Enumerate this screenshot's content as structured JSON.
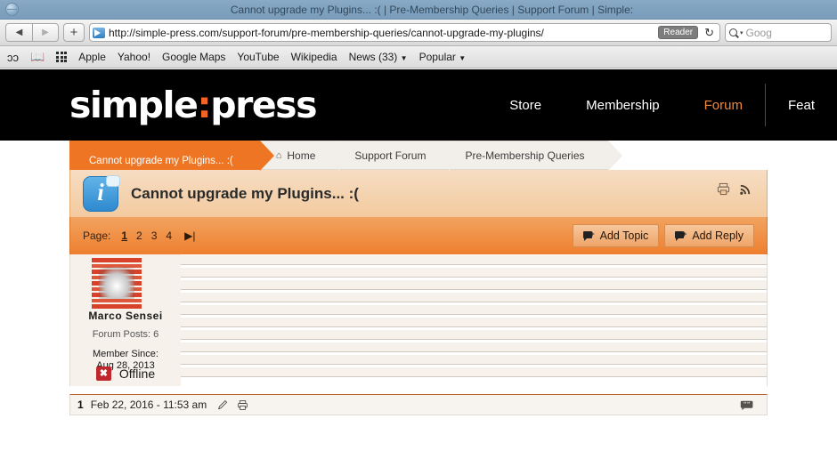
{
  "window": {
    "title": "Cannot upgrade my Plugins... :( | Pre-Membership Queries | Support Forum | Simple:",
    "globe_icon": "globe-icon"
  },
  "toolbar": {
    "back_label": "◀",
    "forward_label": "▶",
    "new_tab_label": "+",
    "url": "http://simple-press.com/support-forum/pre-membership-queries/cannot-upgrade-my-plugins/",
    "reader_label": "Reader",
    "reload_label": "↻",
    "search_placeholder": "Goog",
    "favicon_name": "rss-favicon"
  },
  "bookmarks": {
    "icons": [
      "reading-glasses-icon",
      "book-icon",
      "grid-apps-icon"
    ],
    "items": [
      {
        "label": "Apple",
        "caret": false
      },
      {
        "label": "Yahoo!",
        "caret": false
      },
      {
        "label": "Google Maps",
        "caret": false
      },
      {
        "label": "YouTube",
        "caret": false
      },
      {
        "label": "Wikipedia",
        "caret": false
      },
      {
        "label": "News (33)",
        "caret": true
      },
      {
        "label": "Popular",
        "caret": true
      }
    ],
    "caret_glyph": "▼"
  },
  "site": {
    "logo_left": "simple",
    "logo_colon": ":",
    "logo_right": "press",
    "nav": [
      {
        "label": "Store",
        "active": false
      },
      {
        "label": "Membership",
        "active": false
      },
      {
        "label": "Forum",
        "active": true
      },
      {
        "label": "Feat",
        "active": false
      }
    ]
  },
  "breadcrumb": {
    "current": "Cannot upgrade my Plugins... :(",
    "items": [
      {
        "label": "Home",
        "icon": "home-icon"
      },
      {
        "label": "Support Forum",
        "icon": ""
      },
      {
        "label": "Pre-Membership Queries",
        "icon": ""
      }
    ],
    "home_glyph": "⌂"
  },
  "topic": {
    "title": "Cannot upgrade my Plugins... :(",
    "info_letter": "i",
    "print_icon": "printer-icon",
    "rss_icon": "rss-icon"
  },
  "pagination": {
    "label": "Page:",
    "pages": [
      "1",
      "2",
      "3",
      "4"
    ],
    "active_page": "1",
    "last_glyph": "▶|",
    "add_topic_label": "Add Topic",
    "add_reply_label": "Add Reply"
  },
  "post": {
    "author": "Marco  Sensei",
    "role": "Forum Posts: 6",
    "member_since_label": "Member Since:",
    "member_since_value": "Aug 28, 2013",
    "status": "Offline",
    "status_badge": "✖",
    "number": "1",
    "date": "Feb 22, 2016 - 11:53 am",
    "edit_icon": "pencil-icon",
    "print_icon": "printer-icon",
    "quote_icon": "quote-icon"
  },
  "colors": {
    "brand_orange": "#ee7523",
    "header_black": "#000000",
    "title_blue": "#7fa2bf",
    "offline_red": "#c0272d"
  }
}
